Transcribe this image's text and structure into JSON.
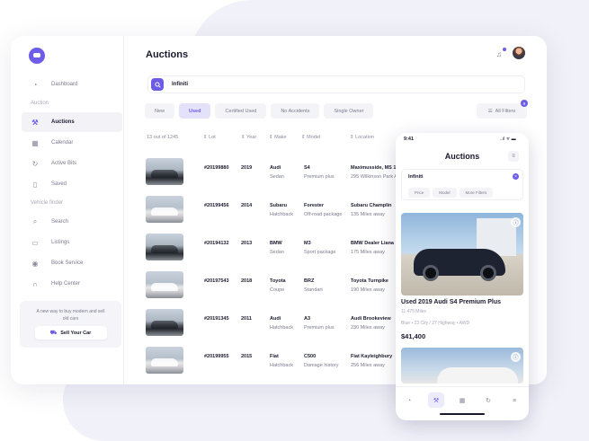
{
  "colors": {
    "accent": "#6c5ce7",
    "text": "#1a1a2e",
    "muted": "#7b7b8f"
  },
  "sidebar": {
    "items": [
      {
        "label": "Dashboard",
        "icon": "dashboard-icon"
      },
      {
        "label": "Auctions",
        "icon": "gavel-icon",
        "active": true
      },
      {
        "label": "Calendar",
        "icon": "calendar-icon"
      },
      {
        "label": "Active Bits",
        "icon": "refresh-icon"
      },
      {
        "label": "Saved",
        "icon": "bookmark-icon"
      },
      {
        "label": "Search",
        "icon": "search-icon"
      },
      {
        "label": "Listings",
        "icon": "listings-icon"
      },
      {
        "label": "Book Service",
        "icon": "target-icon"
      },
      {
        "label": "Help Center",
        "icon": "headset-icon"
      }
    ],
    "section_auction": "Auction",
    "section_finder": "Vehicle finder",
    "promo_text": "A new way to buy modern and sell old cars",
    "promo_button": "Sell Your Car"
  },
  "header": {
    "title": "Auctions"
  },
  "search": {
    "value": "Infiniti"
  },
  "filters": {
    "chips": [
      {
        "label": "New"
      },
      {
        "label": "Used",
        "active": true
      },
      {
        "label": "Certified Used"
      },
      {
        "label": "No Accidents"
      },
      {
        "label": "Single Owner"
      }
    ],
    "all_filters": "All Filters",
    "badge": "9"
  },
  "table": {
    "count": "13 out of 1245",
    "headers": [
      "Lot",
      "Year",
      "Make",
      "Model",
      "Location"
    ],
    "rows": [
      {
        "lot": "#20199880",
        "year": "2019",
        "make": "Audi",
        "type": "Sedan",
        "model": "S4",
        "pkg": "Premium plus",
        "loc": "Maximusside, MS 13484",
        "dist": "295 Wilkinson Park Apt."
      },
      {
        "lot": "#20199456",
        "year": "2014",
        "make": "Subaru",
        "type": "Hatchback",
        "model": "Forester",
        "pkg": "Off-road package",
        "loc": "Subaru Champlin",
        "dist": "135 Miles away"
      },
      {
        "lot": "#20194132",
        "year": "2013",
        "make": "BMW",
        "type": "Sedan",
        "model": "M3",
        "pkg": "Sport package",
        "loc": "BMW Dealer Liana",
        "dist": "175 Miles away"
      },
      {
        "lot": "#20197543",
        "year": "2018",
        "make": "Toyota",
        "type": "Coupe",
        "model": "BRZ",
        "pkg": "Standart",
        "loc": "Toyota Turnpike",
        "dist": "190 Miles away"
      },
      {
        "lot": "#20191345",
        "year": "2011",
        "make": "Audi",
        "type": "Hatchback",
        "model": "A3",
        "pkg": "Premium plus",
        "loc": "Audi Brookeview",
        "dist": "230 Miles away"
      },
      {
        "lot": "#20199955",
        "year": "2015",
        "make": "Fiat",
        "type": "Hatchback",
        "model": "C500",
        "pkg": "Damage history",
        "loc": "Fiat Kayleighbury",
        "dist": "256 Miles away"
      }
    ]
  },
  "mobile": {
    "time": "9:41",
    "status": "..ıl ᯤ ▬",
    "title": "Auctions",
    "search": "Infiniti",
    "chips": [
      "Price",
      "Model",
      "More Filters"
    ],
    "listing": {
      "name": "Used 2019 Audi S4 Premium Plus",
      "miles": "11,475 Miles",
      "spec": "Blue • 23 City / 27 Highway • AWD",
      "price": "$41,400"
    }
  }
}
